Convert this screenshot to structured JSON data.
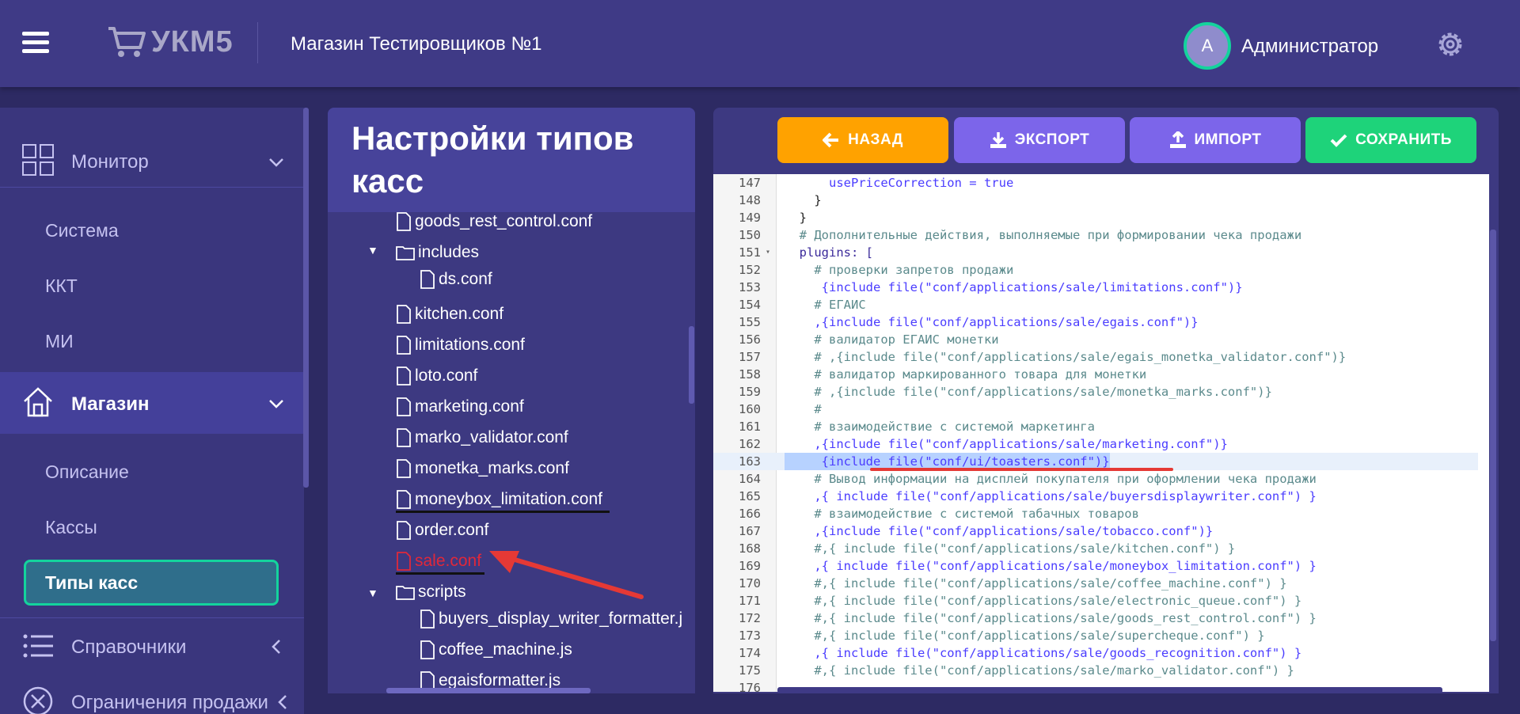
{
  "header": {
    "logo_text": "УКМ5",
    "store_name": "Магазин Тестировщиков №1",
    "avatar_letter": "A",
    "user_name": "Администратор"
  },
  "sidebar": {
    "monitor_label": "Монитор",
    "system_label": "Система",
    "kkt_label": "ККТ",
    "mi_label": "МИ",
    "store_label": "Магазин",
    "description_label": "Описание",
    "cashdesks_label": "Кассы",
    "cashdesk_types_label": "Типы касс",
    "references_label": "Справочники",
    "sale_restrictions_label": "Ограничения продажи"
  },
  "tree": {
    "title": "Настройки типов касс",
    "items": [
      {
        "label": "goods_rest_control.conf"
      },
      {
        "label": "includes"
      },
      {
        "label": "ds.conf"
      },
      {
        "label": "kitchen.conf"
      },
      {
        "label": "limitations.conf"
      },
      {
        "label": "loto.conf"
      },
      {
        "label": "marketing.conf"
      },
      {
        "label": "marko_validator.conf"
      },
      {
        "label": "monetka_marks.conf"
      },
      {
        "label": "moneybox_limitation.conf"
      },
      {
        "label": "order.conf"
      },
      {
        "label": "sale.conf"
      },
      {
        "label": "scripts"
      },
      {
        "label": "buyers_display_writer_formatter.j"
      },
      {
        "label": "coffee_machine.js"
      },
      {
        "label": "egaisformatter.js"
      }
    ]
  },
  "toolbar": {
    "back_label": "НАЗАД",
    "export_label": "ЭКСПОРТ",
    "import_label": "ИМПОРТ",
    "save_label": "СОХРАНИТЬ"
  },
  "colors": {
    "back": "#ffa200",
    "export": "#7c65ea",
    "import": "#7c65ea",
    "save": "#1ed37a",
    "accent": "#14d39d"
  },
  "editor": {
    "lines": [
      {
        "n": "147",
        "t": "      usePriceCorrection = true"
      },
      {
        "n": "148",
        "t": "    }"
      },
      {
        "n": "149",
        "t": "  }"
      },
      {
        "n": "150",
        "t": "  # Дополнительные действия, выполняемые при формировании чека продажи"
      },
      {
        "n": "151",
        "t": "  plugins: ["
      },
      {
        "n": "152",
        "t": "    # проверки запретов продажи"
      },
      {
        "n": "153",
        "t": "     {include file(\"conf/applications/sale/limitations.conf\")}"
      },
      {
        "n": "154",
        "t": "    # ЕГАИС"
      },
      {
        "n": "155",
        "t": "    ,{include file(\"conf/applications/sale/egais.conf\")}"
      },
      {
        "n": "156",
        "t": "    # валидатор ЕГАИС монетки"
      },
      {
        "n": "157",
        "t": "    # ,{include file(\"conf/applications/sale/egais_monetka_validator.conf\")}"
      },
      {
        "n": "158",
        "t": "    # валидатор маркированного товара для монетки"
      },
      {
        "n": "159",
        "t": "    # ,{include file(\"conf/applications/sale/monetka_marks.conf\")}"
      },
      {
        "n": "160",
        "t": "    #"
      },
      {
        "n": "161",
        "t": "    # взаимодействие с системой маркетинга"
      },
      {
        "n": "162",
        "t": "    ,{include file(\"conf/applications/sale/marketing.conf\")}"
      },
      {
        "n": "163",
        "t": "     {include file(\"conf/ui/toasters.conf\")}"
      },
      {
        "n": "164",
        "t": "    # Вывод информации на дисплей покупателя при оформлении чека продажи"
      },
      {
        "n": "165",
        "t": "    ,{ include file(\"conf/applications/sale/buyersdisplaywriter.conf\") }"
      },
      {
        "n": "166",
        "t": "    # взаимодействие с системой табачных товаров"
      },
      {
        "n": "167",
        "t": "    ,{include file(\"conf/applications/sale/tobacco.conf\")}"
      },
      {
        "n": "168",
        "t": "    #,{ include file(\"conf/applications/sale/kitchen.conf\") }"
      },
      {
        "n": "169",
        "t": "    ,{ include file(\"conf/applications/sale/moneybox_limitation.conf\") }"
      },
      {
        "n": "170",
        "t": "    #,{ include file(\"conf/applications/sale/coffee_machine.conf\") }"
      },
      {
        "n": "171",
        "t": "    #,{ include file(\"conf/applications/sale/electronic_queue.conf\") }"
      },
      {
        "n": "172",
        "t": "    #,{ include file(\"conf/applications/sale/goods_rest_control.conf\") }"
      },
      {
        "n": "173",
        "t": "    #,{ include file(\"conf/applications/sale/supercheque.conf\") }"
      },
      {
        "n": "174",
        "t": "    ,{ include file(\"conf/applications/sale/goods_recognition.conf\") }"
      },
      {
        "n": "175",
        "t": "    #,{ include file(\"conf/applications/sale/marko_validator.conf\") }"
      },
      {
        "n": "176",
        "t": ""
      }
    ]
  }
}
